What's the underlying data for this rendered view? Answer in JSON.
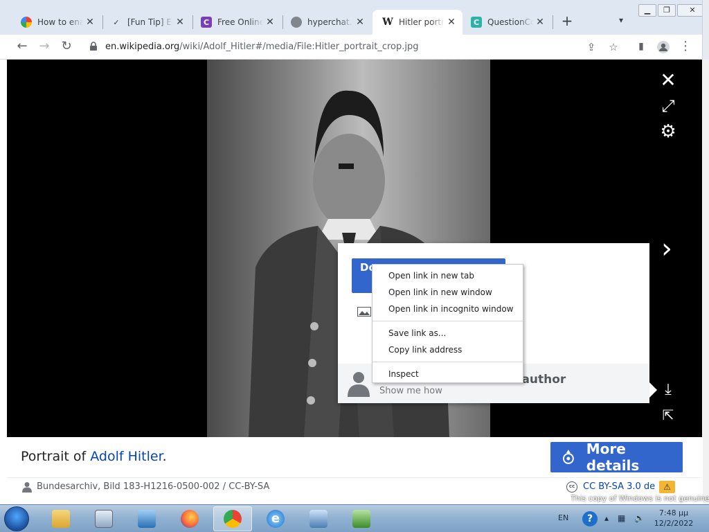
{
  "tabs": [
    {
      "title": "How to enable",
      "icon": "colorful-flower-icon",
      "color": "#d93025",
      "active": false
    },
    {
      "title": "[Fun Tip] Enable",
      "icon": "checkmark-hand-icon",
      "color": "#3c4043",
      "active": false
    },
    {
      "title": "Free Online AI",
      "icon": "c-logo-icon",
      "color": "#7b3fb5",
      "active": false
    },
    {
      "title": "hyperchat.site",
      "icon": "globe-icon",
      "color": "#5f6368",
      "active": false
    },
    {
      "title": "Hitler portrait",
      "icon": "wikipedia-w-icon",
      "color": "#202124",
      "active": true
    },
    {
      "title": "QuestionCopy",
      "icon": "c-square-icon",
      "color": "#2bb3a5",
      "active": false
    }
  ],
  "url": {
    "host": "en.wikipedia.org",
    "path": "/wiki/Adolf_Hitler#/media/File:Hitler_portrait_crop.jpg"
  },
  "popup": {
    "download_button_label": "Do",
    "author_text_tail": "e author",
    "show_me_how": "Show me how"
  },
  "context_menu": {
    "items": [
      "Open link in new tab",
      "Open link in new window",
      "Open link in incognito window",
      "Save link as...",
      "Copy link address",
      "Inspect"
    ]
  },
  "caption": {
    "prefix": "Portrait of ",
    "link": "Adolf Hitler",
    "suffix": "."
  },
  "more_details_label": "More details",
  "attribution": {
    "credit": "Bundesarchiv, Bild 183-H1216-0500-002 / CC-BY-SA",
    "cc_mark": "cc",
    "license": "CC BY-SA 3.0 de"
  },
  "windows_activation_text": "This copy of Windows is not genuine",
  "taskbar": {
    "language": "EN",
    "help": "?",
    "time": "7:48 μμ",
    "date": "12/2/2022"
  },
  "colors": {
    "wiki_blue": "#3366cc",
    "link_blue": "#0645ad",
    "tabstrip": "#dfe7f2"
  }
}
